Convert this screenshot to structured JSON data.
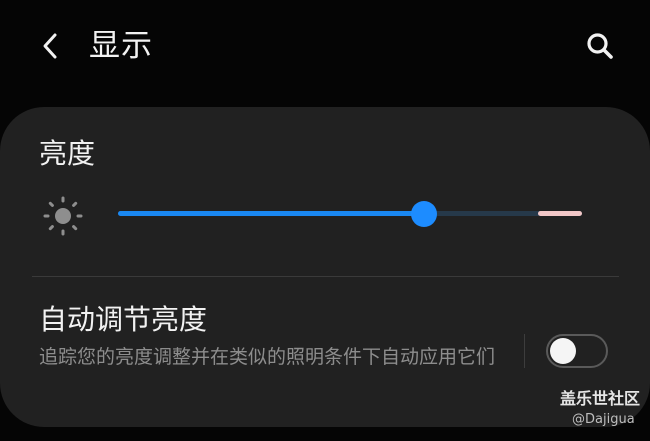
{
  "header": {
    "title": "显示",
    "back_icon": "chevron-left-icon",
    "search_icon": "search-icon"
  },
  "brightness": {
    "label": "亮度",
    "icon": "sun-icon",
    "level": 0.66,
    "colors": {
      "fill": "#1a88f2",
      "track": "#26394a",
      "thumb": "#1d8cff",
      "extra_range": "#f2c7c7"
    }
  },
  "adaptive": {
    "title": "自动调节亮度",
    "description": "追踪您的亮度调整并在类似的照明条件下自动应用它们",
    "toggle_on": false
  },
  "watermark": {
    "logo": "盖乐世社区",
    "handle": "@Dajigua"
  }
}
